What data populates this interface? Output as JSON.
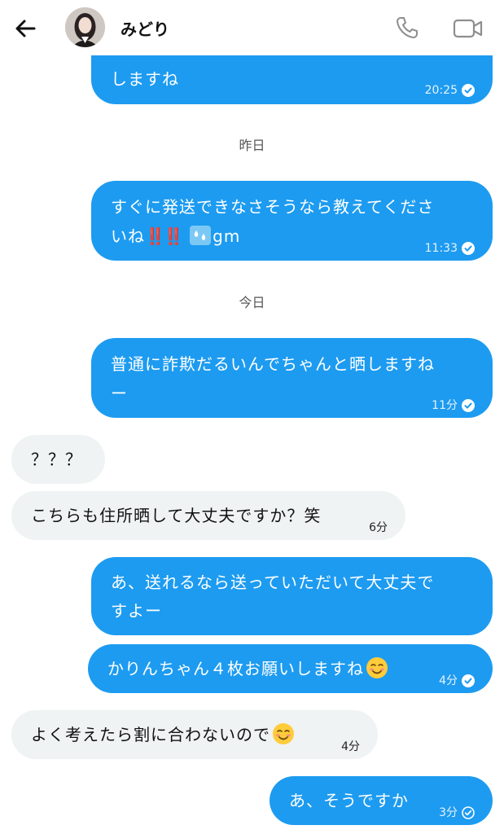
{
  "header": {
    "contact_name": "みどり",
    "back_icon": "arrow-left-icon",
    "call_icon": "phone-icon",
    "video_icon": "video-camera-icon"
  },
  "colors": {
    "outgoing": "#1d9bf0",
    "incoming": "#eff3f4",
    "exclamation": "#e0245e"
  },
  "messages": [
    {
      "dir": "out",
      "text": "しますね",
      "time": "20:25",
      "status": "read"
    },
    {
      "day": "昨日"
    },
    {
      "dir": "out",
      "line1": "すぐに発送できなさそうなら教えてくださ",
      "line2_prefix": "いね",
      "line2_bangs": "‼️‼️",
      "line2_suffix": "gm",
      "time": "11:33",
      "status": "read"
    },
    {
      "day": "今日"
    },
    {
      "dir": "out",
      "line1": "普通に詐欺だるいんでちゃんと晒しますね",
      "line2": "ー",
      "time": "11分",
      "status": "read"
    },
    {
      "dir": "in",
      "text": "？？？"
    },
    {
      "dir": "in",
      "text": "こちらも住所晒して大丈夫ですか？笑",
      "time": "6分"
    },
    {
      "dir": "out",
      "line1": "あ、送れるなら送っていただいて大丈夫で",
      "line2": "すよー"
    },
    {
      "dir": "out",
      "text": "かりんちゃん４枚お願いしますね",
      "emoji": "smiling-face-icon",
      "time": "4分",
      "status": "read"
    },
    {
      "dir": "in",
      "text": "よく考えたら割に合わないので",
      "emoji": "smiling-face-icon",
      "time": "4分"
    },
    {
      "dir": "out",
      "text": "あ、そうですか",
      "time": "3分",
      "status": "sent"
    }
  ]
}
